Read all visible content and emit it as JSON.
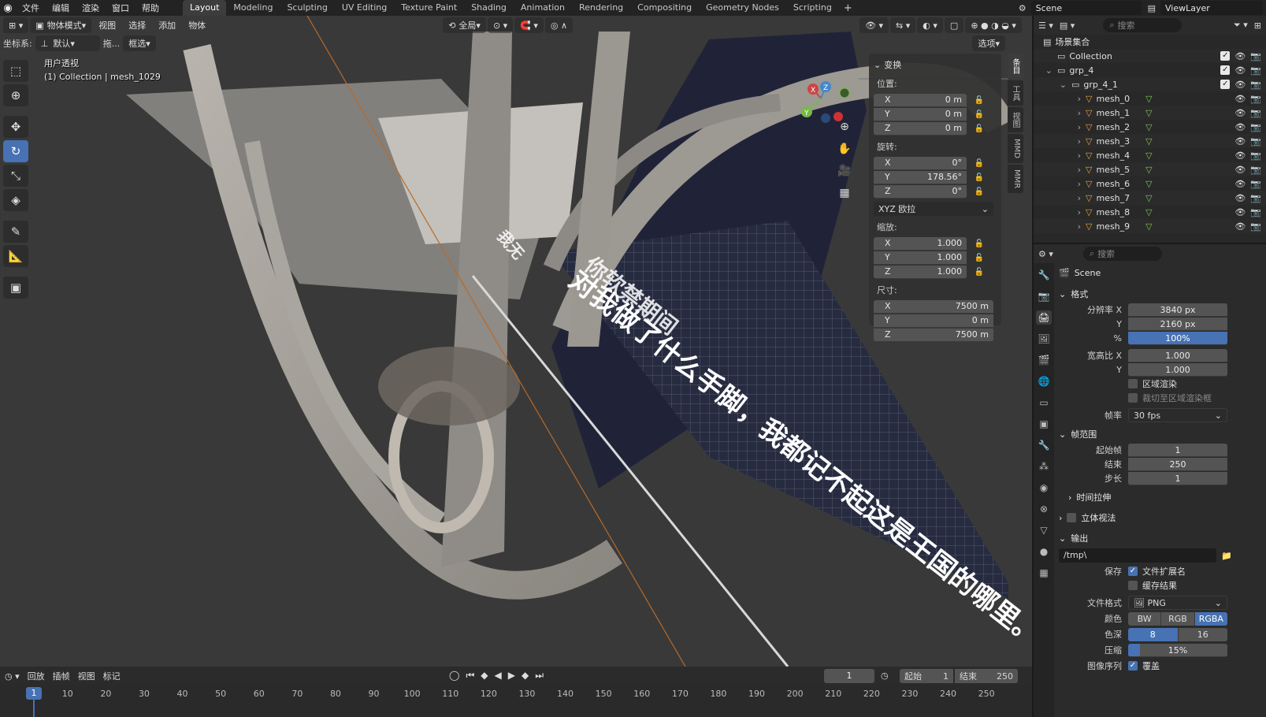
{
  "menubar": {
    "menus": [
      "文件",
      "编辑",
      "渲染",
      "窗口",
      "帮助"
    ],
    "workspaces": [
      "Layout",
      "Modeling",
      "Sculpting",
      "UV Editing",
      "Texture Paint",
      "Shading",
      "Animation",
      "Rendering",
      "Compositing",
      "Geometry Nodes",
      "Scripting"
    ],
    "active_workspace": "Layout",
    "scene": "Scene",
    "view_layer": "ViewLayer"
  },
  "viewport": {
    "mode": "物体模式",
    "menus": [
      "视图",
      "选择",
      "添加",
      "物体"
    ],
    "coord_label": "坐标系:",
    "coord_value": "默认",
    "drag_label": "拖...",
    "select_mode": "框选",
    "transform_orient": "全局",
    "options": "选项",
    "info_line1": "用户透视",
    "info_line2": "(1) Collection | mesh_1029",
    "scene_text": "对我做了什么手脚，我都记不起这是王国的哪里。",
    "scene_text2": "你软禁期间",
    "scene_text3": "我无"
  },
  "npanel": {
    "title": "变换",
    "location_label": "位置:",
    "location": [
      {
        "axis": "X",
        "value": "0 m"
      },
      {
        "axis": "Y",
        "value": "0 m"
      },
      {
        "axis": "Z",
        "value": "0 m"
      }
    ],
    "rotation_label": "旋转:",
    "rotation": [
      {
        "axis": "X",
        "value": "0°"
      },
      {
        "axis": "Y",
        "value": "178.56°"
      },
      {
        "axis": "Z",
        "value": "0°"
      }
    ],
    "rotation_mode": "XYZ 欧拉",
    "scale_label": "缩放:",
    "scale": [
      {
        "axis": "X",
        "value": "1.000"
      },
      {
        "axis": "Y",
        "value": "1.000"
      },
      {
        "axis": "Z",
        "value": "1.000"
      }
    ],
    "dimensions_label": "尺寸:",
    "dimensions": [
      {
        "axis": "X",
        "value": "7500 m"
      },
      {
        "axis": "Y",
        "value": "0 m"
      },
      {
        "axis": "Z",
        "value": "7500 m"
      }
    ],
    "side_tabs": [
      "条目",
      "工具",
      "视图",
      "MMD",
      "MMR"
    ]
  },
  "outliner": {
    "search_placeholder": "搜索",
    "rows": [
      {
        "label": "场景集合",
        "indent": 0
      },
      {
        "label": "Collection",
        "indent": 1
      },
      {
        "label": "grp_4",
        "indent": 1
      },
      {
        "label": "grp_4_1",
        "indent": 2
      },
      {
        "label": "mesh_0",
        "indent": 3
      },
      {
        "label": "mesh_1",
        "indent": 3
      },
      {
        "label": "mesh_2",
        "indent": 3
      },
      {
        "label": "mesh_3",
        "indent": 3
      },
      {
        "label": "mesh_4",
        "indent": 3
      },
      {
        "label": "mesh_5",
        "indent": 3
      },
      {
        "label": "mesh_6",
        "indent": 3
      },
      {
        "label": "mesh_7",
        "indent": 3
      },
      {
        "label": "mesh_8",
        "indent": 3
      },
      {
        "label": "mesh_9",
        "indent": 3
      }
    ]
  },
  "properties": {
    "search_placeholder": "搜索",
    "crumb": "Scene",
    "format": {
      "title": "格式",
      "res_x_label": "分辨率 X",
      "res_x": "3840 px",
      "res_y_label": "Y",
      "res_y": "2160 px",
      "pct_label": "%",
      "pct": "100%",
      "aspect_x_label": "宽高比 X",
      "aspect_x": "1.000",
      "aspect_y_label": "Y",
      "aspect_y": "1.000",
      "region_render": "区域渲染",
      "crop": "裁切至区域渲染框",
      "fps_label": "帧率",
      "fps": "30 fps"
    },
    "frame_range": {
      "title": "帧范围",
      "start_label": "起始帧",
      "start": "1",
      "end_label": "结束",
      "end": "250",
      "step_label": "步长",
      "step": "1",
      "time_stretch": "时间拉伸",
      "stereo": "立体视法"
    },
    "output": {
      "title": "输出",
      "path": "/tmp\\",
      "save_label": "保存",
      "file_ext": "文件扩展名",
      "cache": "缓存结果",
      "format_label": "文件格式",
      "format": "PNG",
      "color_label": "颜色",
      "color_modes": [
        "BW",
        "RGB",
        "RGBA"
      ],
      "color_active": "RGBA",
      "depth_label": "色深",
      "depths": [
        "8",
        "16"
      ],
      "depth_active": "8",
      "compress_label": "压缩",
      "compress": "15%",
      "sequence_label": "图像序列",
      "overwrite": "覆盖"
    }
  },
  "timeline": {
    "menus": [
      "回放",
      "插帧",
      "视图",
      "标记"
    ],
    "current_frame": "1",
    "start_label": "起始",
    "start": "1",
    "end_label": "结束",
    "end": "250",
    "ruler": [
      "1",
      "10",
      "20",
      "30",
      "40",
      "50",
      "60",
      "70",
      "80",
      "90",
      "100",
      "110",
      "120",
      "130",
      "140",
      "150",
      "160",
      "170",
      "180",
      "190",
      "200",
      "210",
      "220",
      "230",
      "240",
      "250"
    ]
  },
  "colors": {
    "accent": "#4772b3",
    "mesh_orange": "#e8a040",
    "mesh_green": "#7fc35a"
  }
}
